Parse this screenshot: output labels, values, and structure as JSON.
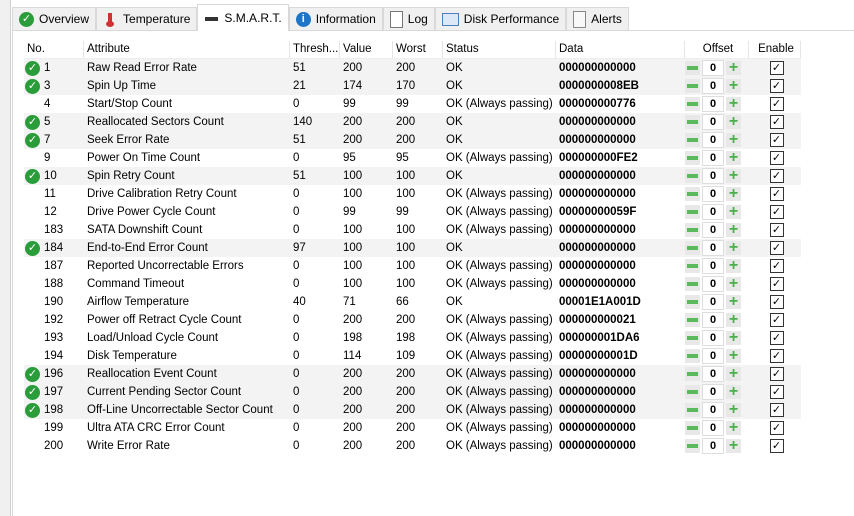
{
  "tabs": [
    {
      "label": "Overview",
      "icon": "check-circle-icon"
    },
    {
      "label": "Temperature",
      "icon": "thermometer-icon"
    },
    {
      "label": "S.M.A.R.T.",
      "icon": "drive-icon",
      "active": true
    },
    {
      "label": "Information",
      "icon": "info-icon"
    },
    {
      "label": "Log",
      "icon": "document-icon"
    },
    {
      "label": "Disk Performance",
      "icon": "chart-icon"
    },
    {
      "label": "Alerts",
      "icon": "clipboard-icon"
    }
  ],
  "columns": [
    "No.",
    "Attribute",
    "Thresh...",
    "Value",
    "Worst",
    "Status",
    "Data",
    "Offset",
    "Enable"
  ],
  "rows": [
    {
      "no": "1",
      "attr": "Raw Read Error Rate",
      "thresh": "51",
      "value": "200",
      "worst": "200",
      "status": "OK",
      "data": "000000000000",
      "offset": "0",
      "check": true
    },
    {
      "no": "3",
      "attr": "Spin Up Time",
      "thresh": "21",
      "value": "174",
      "worst": "170",
      "status": "OK",
      "data": "0000000008EB",
      "offset": "0",
      "check": true
    },
    {
      "no": "4",
      "attr": "Start/Stop Count",
      "thresh": "0",
      "value": "99",
      "worst": "99",
      "status": "OK (Always passing)",
      "data": "000000000776",
      "offset": "0",
      "check": false
    },
    {
      "no": "5",
      "attr": "Reallocated Sectors Count",
      "thresh": "140",
      "value": "200",
      "worst": "200",
      "status": "OK",
      "data": "000000000000",
      "offset": "0",
      "check": true
    },
    {
      "no": "7",
      "attr": "Seek Error Rate",
      "thresh": "51",
      "value": "200",
      "worst": "200",
      "status": "OK",
      "data": "000000000000",
      "offset": "0",
      "check": true
    },
    {
      "no": "9",
      "attr": "Power On Time Count",
      "thresh": "0",
      "value": "95",
      "worst": "95",
      "status": "OK (Always passing)",
      "data": "000000000FE2",
      "offset": "0",
      "check": false
    },
    {
      "no": "10",
      "attr": "Spin Retry Count",
      "thresh": "51",
      "value": "100",
      "worst": "100",
      "status": "OK",
      "data": "000000000000",
      "offset": "0",
      "check": true
    },
    {
      "no": "11",
      "attr": "Drive Calibration Retry Count",
      "thresh": "0",
      "value": "100",
      "worst": "100",
      "status": "OK (Always passing)",
      "data": "000000000000",
      "offset": "0",
      "check": false
    },
    {
      "no": "12",
      "attr": "Drive Power Cycle Count",
      "thresh": "0",
      "value": "99",
      "worst": "99",
      "status": "OK (Always passing)",
      "data": "00000000059F",
      "offset": "0",
      "check": false
    },
    {
      "no": "183",
      "attr": "SATA Downshift Count",
      "thresh": "0",
      "value": "100",
      "worst": "100",
      "status": "OK (Always passing)",
      "data": "000000000000",
      "offset": "0",
      "check": false
    },
    {
      "no": "184",
      "attr": "End-to-End Error Count",
      "thresh": "97",
      "value": "100",
      "worst": "100",
      "status": "OK",
      "data": "000000000000",
      "offset": "0",
      "check": true
    },
    {
      "no": "187",
      "attr": "Reported Uncorrectable Errors",
      "thresh": "0",
      "value": "100",
      "worst": "100",
      "status": "OK (Always passing)",
      "data": "000000000000",
      "offset": "0",
      "check": false
    },
    {
      "no": "188",
      "attr": "Command Timeout",
      "thresh": "0",
      "value": "100",
      "worst": "100",
      "status": "OK (Always passing)",
      "data": "000000000000",
      "offset": "0",
      "check": false
    },
    {
      "no": "190",
      "attr": "Airflow Temperature",
      "thresh": "40",
      "value": "71",
      "worst": "66",
      "status": "OK",
      "data": "00001E1A001D",
      "offset": "0",
      "check": false
    },
    {
      "no": "192",
      "attr": "Power off Retract Cycle Count",
      "thresh": "0",
      "value": "200",
      "worst": "200",
      "status": "OK (Always passing)",
      "data": "000000000021",
      "offset": "0",
      "check": false
    },
    {
      "no": "193",
      "attr": "Load/Unload Cycle Count",
      "thresh": "0",
      "value": "198",
      "worst": "198",
      "status": "OK (Always passing)",
      "data": "000000001DA6",
      "offset": "0",
      "check": false
    },
    {
      "no": "194",
      "attr": "Disk Temperature",
      "thresh": "0",
      "value": "114",
      "worst": "109",
      "status": "OK (Always passing)",
      "data": "00000000001D",
      "offset": "0",
      "check": false
    },
    {
      "no": "196",
      "attr": "Reallocation Event Count",
      "thresh": "0",
      "value": "200",
      "worst": "200",
      "status": "OK (Always passing)",
      "data": "000000000000",
      "offset": "0",
      "check": true
    },
    {
      "no": "197",
      "attr": "Current Pending Sector Count",
      "thresh": "0",
      "value": "200",
      "worst": "200",
      "status": "OK (Always passing)",
      "data": "000000000000",
      "offset": "0",
      "check": true
    },
    {
      "no": "198",
      "attr": "Off-Line Uncorrectable Sector Count",
      "thresh": "0",
      "value": "200",
      "worst": "200",
      "status": "OK (Always passing)",
      "data": "000000000000",
      "offset": "0",
      "check": true
    },
    {
      "no": "199",
      "attr": "Ultra ATA CRC Error Count",
      "thresh": "0",
      "value": "200",
      "worst": "200",
      "status": "OK (Always passing)",
      "data": "000000000000",
      "offset": "0",
      "check": false
    },
    {
      "no": "200",
      "attr": "Write Error Rate",
      "thresh": "0",
      "value": "200",
      "worst": "200",
      "status": "OK (Always passing)",
      "data": "000000000000",
      "offset": "0",
      "check": false
    }
  ]
}
